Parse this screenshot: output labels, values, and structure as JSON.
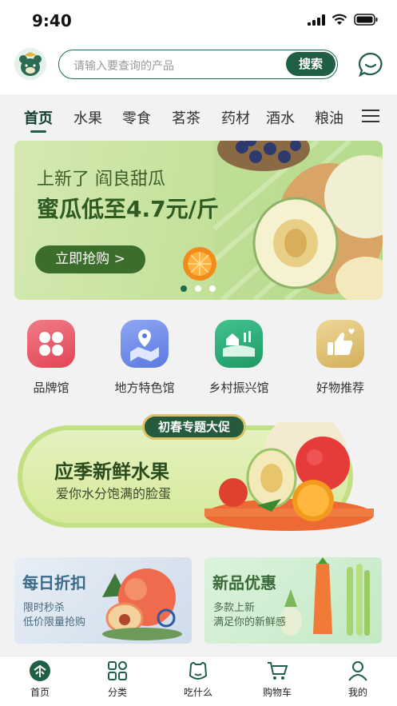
{
  "status_bar": {
    "time": "9:40"
  },
  "search": {
    "placeholder": "请输入要查询的产品",
    "button_label": "搜索"
  },
  "tabs": [
    {
      "label": "首页",
      "active": true
    },
    {
      "label": "水果"
    },
    {
      "label": "零食"
    },
    {
      "label": "茗茶"
    },
    {
      "label": "药材"
    },
    {
      "label": "酒水"
    },
    {
      "label": "粮油"
    }
  ],
  "banner": {
    "line1": "上新了 阎良甜瓜",
    "line2": "蜜瓜低至4.7元/斤",
    "cta": "立即抢购 >",
    "slide_count": 3,
    "active_slide": 1
  },
  "quick_links": [
    {
      "label": "品牌馆",
      "icon": "brand-hall-icon",
      "color": "#e9525f"
    },
    {
      "label": "地方特色馆",
      "icon": "map-location-icon",
      "color": "#6a86e6"
    },
    {
      "label": "乡村振兴馆",
      "icon": "village-icon",
      "color": "#2bb07a"
    },
    {
      "label": "好物推荐",
      "icon": "thumbs-up-icon",
      "color": "#d9b75a"
    }
  ],
  "promo": {
    "tag": "初春专题大促",
    "title": "应季新鲜水果",
    "subtitle": "爱你水分饱满的脸蛋"
  },
  "cards": [
    {
      "title": "每日折扣",
      "line1": "限时秒杀",
      "line2": "低价限量抢购"
    },
    {
      "title": "新品优惠",
      "line1": "多款上新",
      "line2": "满足你的新鲜感"
    }
  ],
  "nav": [
    {
      "label": "首页",
      "icon": "home-icon",
      "active": true
    },
    {
      "label": "分类",
      "icon": "category-icon"
    },
    {
      "label": "吃什么",
      "icon": "food-icon"
    },
    {
      "label": "购物车",
      "icon": "cart-icon"
    },
    {
      "label": "我的",
      "icon": "profile-icon"
    }
  ],
  "colors": {
    "brand": "#1f5f45",
    "banner_green": "#c3e19a",
    "text_dark": "#222222"
  }
}
